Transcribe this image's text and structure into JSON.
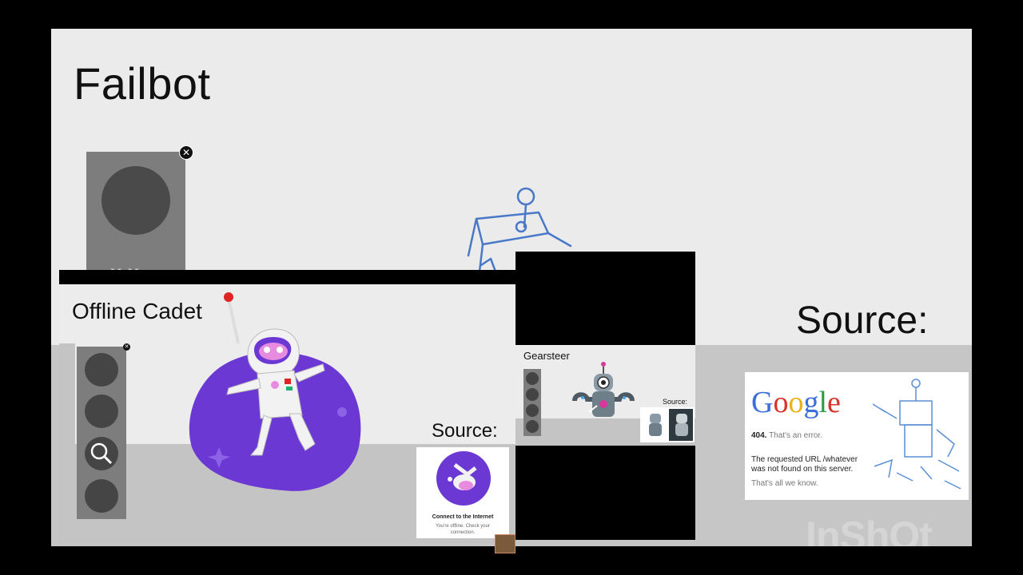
{
  "failbot": {
    "title": "Failbot",
    "eyes": "x x"
  },
  "source_right": {
    "label": "Source:",
    "google_card": {
      "logo_letters": [
        {
          "ch": "G",
          "color": "#3b6fd8"
        },
        {
          "ch": "o",
          "color": "#d8342c"
        },
        {
          "ch": "o",
          "color": "#e8b21a"
        },
        {
          "ch": "g",
          "color": "#3b6fd8"
        },
        {
          "ch": "l",
          "color": "#2e9a48"
        },
        {
          "ch": "e",
          "color": "#d8342c"
        }
      ],
      "error_code": "404.",
      "error_short": "That's an error.",
      "message": "The requested URL /whatever was not found on this server.",
      "footer": "That's all we know."
    }
  },
  "offline_cadet": {
    "title": "Offline Cadet",
    "source_label": "Source:",
    "card_title": "Connect to the Internet",
    "card_subtitle": "You're offline. Check your connection."
  },
  "gearsteer": {
    "title": "Gearsteer",
    "source_label": "Source:"
  },
  "watermark": "InShOt",
  "icons": {
    "close": "close-icon",
    "magnifier": "magnifier-icon",
    "astronaut": "astronaut-illustration",
    "robot": "robot-illustration"
  }
}
